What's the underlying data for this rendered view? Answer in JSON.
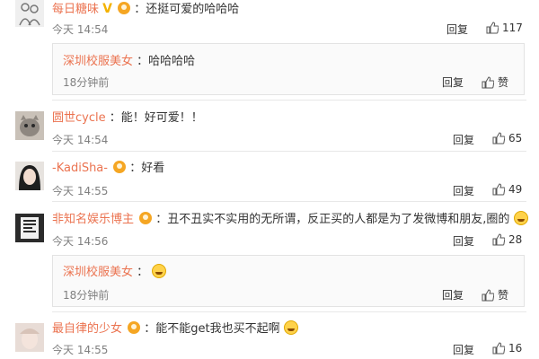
{
  "comments": [
    {
      "name": "每日糖味",
      "text": "：还挺可爱的哈哈哈",
      "time": "今天 14:54",
      "reply": "回复",
      "likes": "117"
    },
    {
      "name": "深圳校服美女",
      "text": "：哈哈哈哈",
      "time": "18分钟前",
      "reply": "回复",
      "likes": "赞"
    },
    {
      "name": "圆世cycle",
      "text": "：能！好可爱！！",
      "time": "今天 14:54",
      "reply": "回复",
      "likes": "65"
    },
    {
      "name": "-KadiSha-",
      "text": "：好看",
      "time": "今天 14:55",
      "reply": "回复",
      "likes": "49"
    },
    {
      "name": "非知名娱乐博主",
      "text": "：丑不丑实不实用的无所谓，反正买的人都是为了发微博和朋友,圈的",
      "time": "今天 14:56",
      "reply": "回复",
      "likes": "28"
    },
    {
      "name": "深圳校服美女",
      "text": "：",
      "time": "18分钟前",
      "reply": "回复",
      "likes": "赞"
    },
    {
      "name": "最自律的少女",
      "text": "：能不能get我也买不起啊",
      "time": "今天 14:55",
      "reply": "回复",
      "likes": "16"
    }
  ],
  "icons": {
    "thumb": "thumbs-up-icon",
    "badge": "verified-badge-icon",
    "emoji": "smile-emoji-icon"
  },
  "colors": {
    "name": "#eb7350",
    "time": "#808080",
    "border": "#e3e3e3"
  }
}
